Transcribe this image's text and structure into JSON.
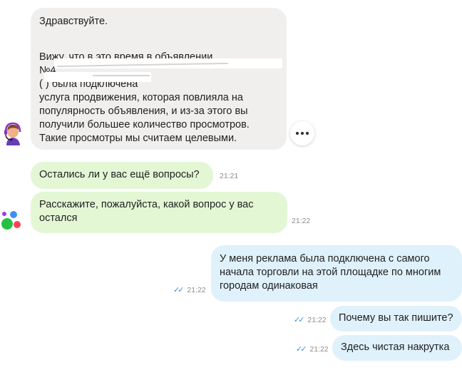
{
  "messages": [
    {
      "from": "support",
      "lines": [
        "Здравствуйте.",
        "",
        "Вижу, что в это время в объявлении",
        "№4",
        "(                       )  была подключена",
        "услуга продвижения, которая повлияла на",
        "популярность объявления, и из-за этого вы",
        "получили большее количество просмотров.",
        "Такие просмотры мы считаем целевыми."
      ]
    },
    {
      "from": "support",
      "text": "Остались ли у вас ещё вопросы?",
      "time": "21:21"
    },
    {
      "from": "support",
      "lines": [
        "Расскажите, пожалуйста, какой вопрос у вас",
        "остался"
      ],
      "time": "21:22"
    },
    {
      "from": "user",
      "lines": [
        "У меня реклама была подключена с самого",
        "начала торговли на этой площадке по многим",
        "городам одинаковая"
      ],
      "time": "21:22",
      "read": true
    },
    {
      "from": "user",
      "text": "Почему вы так пишите?",
      "time": "21:22",
      "read": true
    },
    {
      "from": "user",
      "text": "Здесь чистая накрутка",
      "time": "21:22",
      "read": true
    }
  ],
  "icons": {
    "operator_avatar": "headset-operator-icon",
    "brand_avatar": "brand-dots-icon",
    "more": "more-horizontal-icon",
    "read_receipt": "double-check-icon"
  },
  "colors": {
    "incoming_bubble": "#f1efee",
    "support_green_bubble": "#e3f7d5",
    "outgoing_bubble": "#dff1fb",
    "read_check": "#3d8fe0"
  }
}
